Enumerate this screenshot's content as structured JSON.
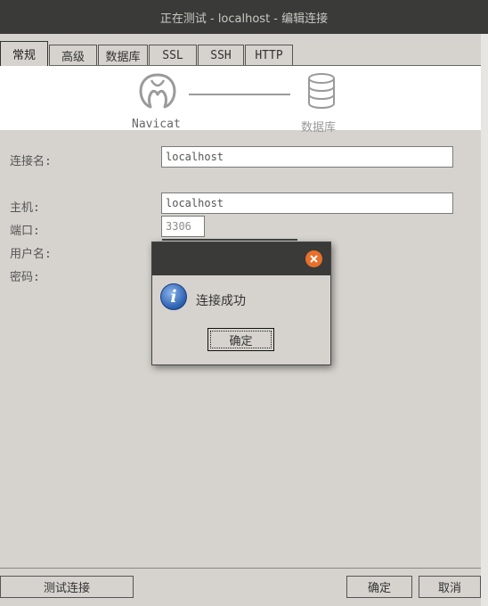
{
  "window": {
    "title": "正在测试 - localhost - 编辑连接"
  },
  "tabs": [
    "常规",
    "高级",
    "数据库",
    "SSL",
    "SSH",
    "HTTP"
  ],
  "active_tab": "常规",
  "header_panel": {
    "left_label": "Navicat",
    "right_label": "数据库"
  },
  "form": {
    "connection_name": {
      "label": "连接名:",
      "value": "localhost"
    },
    "host": {
      "label": "主机:",
      "value": "localhost"
    },
    "port": {
      "label": "端口:",
      "value": "3306"
    },
    "username": {
      "label": "用户名:"
    },
    "password": {
      "label": "密码:"
    }
  },
  "buttons": {
    "test": "测试连接",
    "ok": "确定",
    "cancel": "取消"
  },
  "dialog": {
    "message": "连接成功",
    "ok": "确定",
    "icon": "info-icon",
    "close_color": "#e8702a"
  }
}
